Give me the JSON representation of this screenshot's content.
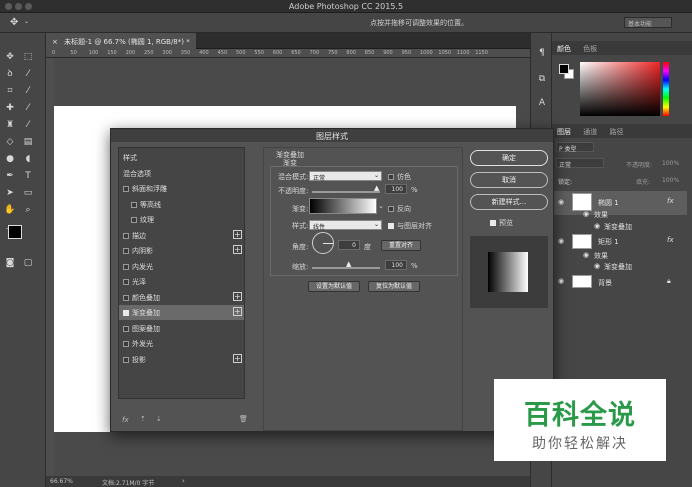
{
  "app": {
    "title": "Adobe Photoshop CC 2015.5"
  },
  "options_bar": {
    "hint": "点按并拖移可调整效果的位置。",
    "workspace": "基本功能"
  },
  "document_tab": {
    "label": "未标题-1 @ 66.7% (椭圆 1, RGB/8*) *",
    "close": "×"
  },
  "ruler_ticks": [
    "0",
    "50",
    "100",
    "150",
    "200",
    "250",
    "300",
    "350",
    "400",
    "450",
    "500",
    "550",
    "600",
    "650",
    "700",
    "750",
    "800",
    "850",
    "900",
    "950",
    "1000",
    "1050",
    "1100",
    "1150"
  ],
  "status": {
    "zoom": "66.67%",
    "doc": "文档:2.71M/0 字节"
  },
  "right_panel": {
    "color_tabs": [
      "颜色",
      "色板"
    ],
    "layers_tabs": [
      "图层",
      "通道",
      "路径"
    ],
    "kind": "P 类型",
    "blend": "正常",
    "opacity_label": "不透明度:",
    "opacity_value": "100%",
    "lock_label": "锁定:",
    "fill_label": "填充:",
    "fill_value": "100%",
    "layers": [
      {
        "name": "椭圆 1",
        "fx": "fx"
      },
      {
        "name": "效果",
        "fx": ""
      },
      {
        "name": "渐变叠加",
        "fx": ""
      },
      {
        "name": "矩形 1",
        "fx": "fx"
      },
      {
        "name": "效果",
        "fx": ""
      },
      {
        "name": "渐变叠加",
        "fx": ""
      },
      {
        "name": "背景",
        "fx": ""
      }
    ]
  },
  "dialog": {
    "title": "图层样式",
    "styles": [
      {
        "label": "样式",
        "check": false,
        "plus": false,
        "sub": false,
        "hasbox": false
      },
      {
        "label": "混合选项",
        "check": false,
        "plus": false,
        "sub": false,
        "hasbox": false
      },
      {
        "label": "斜面和浮雕",
        "check": false,
        "plus": false,
        "sub": false,
        "hasbox": true
      },
      {
        "label": "等高线",
        "check": false,
        "plus": false,
        "sub": true,
        "hasbox": true
      },
      {
        "label": "纹理",
        "check": false,
        "plus": false,
        "sub": true,
        "hasbox": true
      },
      {
        "label": "描边",
        "check": false,
        "plus": true,
        "sub": false,
        "hasbox": true
      },
      {
        "label": "内阴影",
        "check": false,
        "plus": true,
        "sub": false,
        "hasbox": true
      },
      {
        "label": "内发光",
        "check": false,
        "plus": false,
        "sub": false,
        "hasbox": true
      },
      {
        "label": "光泽",
        "check": false,
        "plus": false,
        "sub": false,
        "hasbox": true
      },
      {
        "label": "颜色叠加",
        "check": false,
        "plus": true,
        "sub": false,
        "hasbox": true
      },
      {
        "label": "渐变叠加",
        "check": true,
        "plus": true,
        "sub": false,
        "hasbox": true
      },
      {
        "label": "图案叠加",
        "check": false,
        "plus": false,
        "sub": false,
        "hasbox": true
      },
      {
        "label": "外发光",
        "check": false,
        "plus": false,
        "sub": false,
        "hasbox": true
      },
      {
        "label": "投影",
        "check": false,
        "plus": true,
        "sub": false,
        "hasbox": true
      }
    ],
    "footer_fx": "fx",
    "section_title": "渐变叠加",
    "section_sub": "渐变",
    "blend_label": "混合模式:",
    "blend_value": "正常",
    "dither": "仿色",
    "opacity_label": "不透明度:",
    "opacity_value": "100",
    "percent": "%",
    "gradient_label": "渐变:",
    "reverse": "反向",
    "style_label": "样式:",
    "style_value": "线性",
    "align": "与图层对齐",
    "angle_label": "角度:",
    "angle_value": "0",
    "degree": "度",
    "reset_align": "重置对齐",
    "scale_label": "缩放:",
    "scale_value": "100",
    "set_default": "设置为默认值",
    "reset_default": "复位为默认值",
    "ok": "确定",
    "cancel": "取消",
    "new_style": "新建样式...",
    "preview": "预览"
  },
  "watermark": {
    "line1": "百科全说",
    "line2": "助你轻松解决"
  }
}
